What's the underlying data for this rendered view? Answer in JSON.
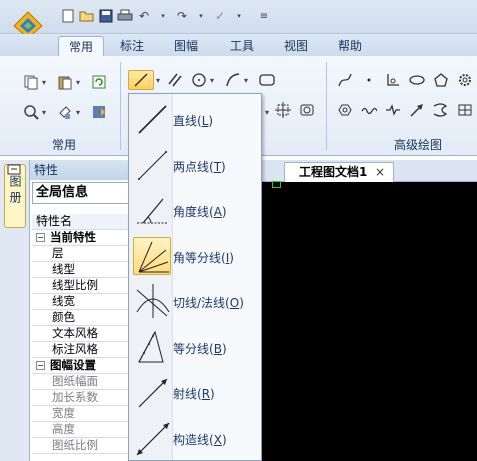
{
  "quick_access": [
    "new-icon",
    "open-icon",
    "save-icon",
    "print-icon",
    "undo-icon",
    "redo-icon",
    "check-icon",
    "customize-icon"
  ],
  "ribbon_tabs": [
    "常用",
    "标注",
    "图幅",
    "工具",
    "视图",
    "帮助"
  ],
  "ribbon_groups": {
    "common": "常用",
    "advanced": "高级绘图"
  },
  "properties_panel": {
    "title": "特性",
    "selector_value": "全局信息",
    "vertical_tab_label": "图 册",
    "header": "特性名",
    "rows": [
      {
        "kind": "cat",
        "toggle": "−",
        "label": "当前特性"
      },
      {
        "kind": "item",
        "label": "层"
      },
      {
        "kind": "item",
        "label": "线型"
      },
      {
        "kind": "item",
        "label": "线型比例"
      },
      {
        "kind": "item",
        "label": "线宽"
      },
      {
        "kind": "item",
        "label": "颜色"
      },
      {
        "kind": "item",
        "label": "文本风格"
      },
      {
        "kind": "item",
        "label": "标注风格"
      },
      {
        "kind": "cat",
        "toggle": "−",
        "label": "图幅设置"
      },
      {
        "kind": "item grey",
        "label": "图纸幅面"
      },
      {
        "kind": "item grey",
        "label": "加长系数"
      },
      {
        "kind": "item grey",
        "label": "宽度"
      },
      {
        "kind": "item grey",
        "label": "高度"
      },
      {
        "kind": "item grey",
        "label": "图纸比例"
      }
    ]
  },
  "document_tab": {
    "title": "工程图文档1",
    "close": "×"
  },
  "line_menu": {
    "items": [
      {
        "label": "直线",
        "key": "L",
        "icon": "straight-line-icon"
      },
      {
        "label": "两点线",
        "key": "T",
        "icon": "two-point-line-icon"
      },
      {
        "label": "角度线",
        "key": "A",
        "icon": "angle-line-icon"
      },
      {
        "label": "角等分线",
        "key": "I",
        "icon": "angle-bisector-icon",
        "active": true
      },
      {
        "label": "切线/法线",
        "key": "O",
        "icon": "tangent-normal-icon"
      },
      {
        "label": "等分线",
        "key": "B",
        "icon": "divide-line-icon"
      },
      {
        "label": "射线",
        "key": "R",
        "icon": "ray-icon"
      },
      {
        "label": "构造线",
        "key": "X",
        "icon": "construction-line-icon"
      }
    ]
  }
}
